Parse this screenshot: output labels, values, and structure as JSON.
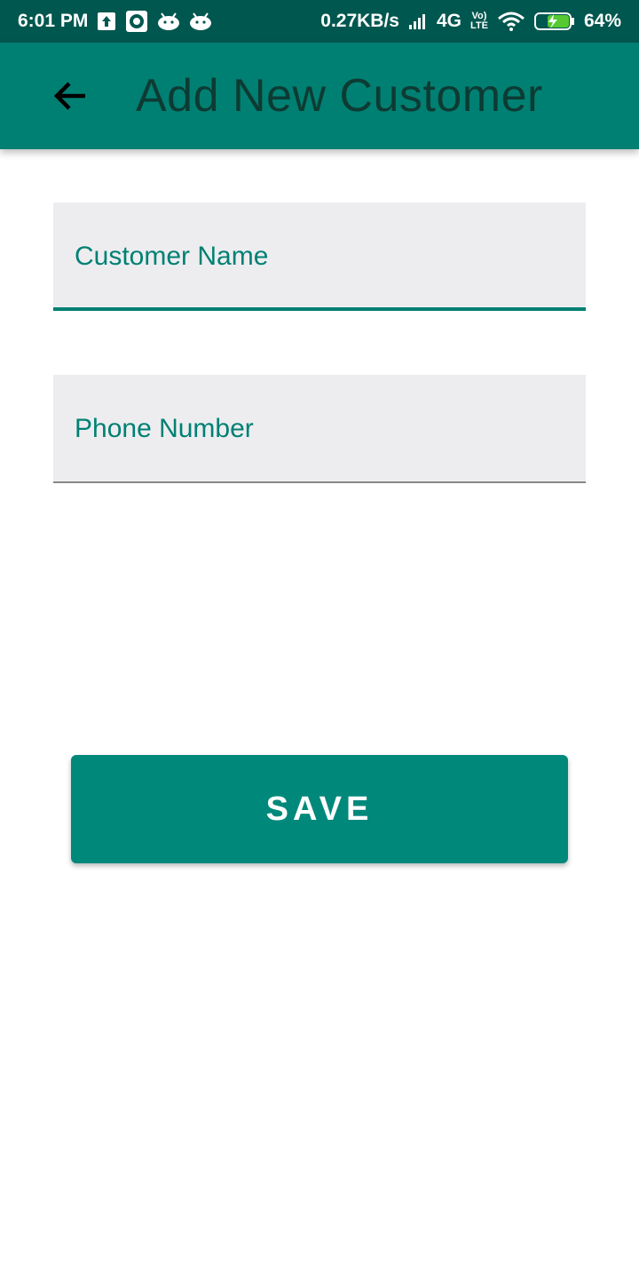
{
  "status_bar": {
    "time": "6:01 PM",
    "net_speed": "0.27KB/s",
    "network": "4G",
    "volte_top": "Vo)",
    "volte_bottom": "LTE",
    "battery": "64%",
    "icons": [
      "upload-icon",
      "record-icon",
      "android-icon",
      "android-icon",
      "signal-icon",
      "wifi-icon",
      "battery-charging-icon"
    ]
  },
  "app_bar": {
    "title": "Add New Customer",
    "back_icon": "arrow-back-icon"
  },
  "form": {
    "customer_name_placeholder": "Customer Name",
    "phone_number_placeholder": "Phone Number"
  },
  "actions": {
    "save_label": "SAVE"
  },
  "colors": {
    "primary": "#008073",
    "primary_dark": "#00574f",
    "button": "#00897b",
    "field_bg": "#ededf0"
  }
}
